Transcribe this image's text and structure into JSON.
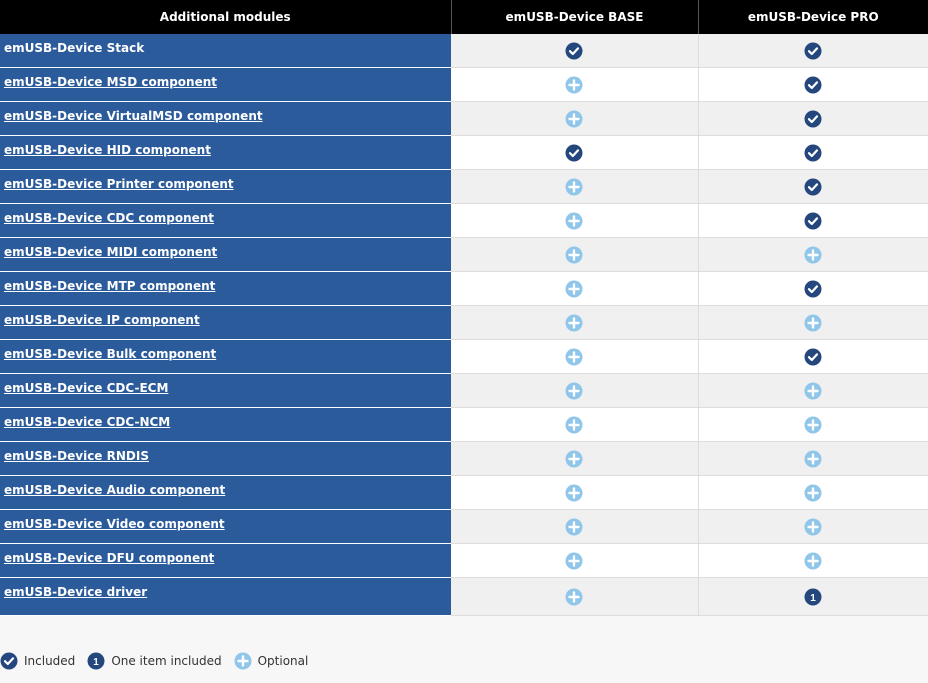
{
  "header": {
    "col1": "Additional modules",
    "col2": "emUSB-Device BASE",
    "col3": "emUSB-Device PRO"
  },
  "rows": [
    {
      "name": "emUSB-Device Stack",
      "base": "included",
      "pro": "included"
    },
    {
      "name": " emUSB-Device MSD component",
      "base": "optional",
      "pro": "included"
    },
    {
      "name": " emUSB-Device VirtualMSD component",
      "base": "optional",
      "pro": "included"
    },
    {
      "name": " emUSB-Device HID component",
      "base": "included",
      "pro": "included"
    },
    {
      "name": " emUSB-Device Printer component",
      "base": "optional",
      "pro": "included"
    },
    {
      "name": " emUSB-Device CDC component",
      "base": "optional",
      "pro": "included"
    },
    {
      "name": " emUSB-Device MIDI component",
      "base": "optional",
      "pro": "optional"
    },
    {
      "name": " emUSB-Device MTP component",
      "base": "optional",
      "pro": "included"
    },
    {
      "name": " emUSB-Device IP component",
      "base": "optional",
      "pro": "optional"
    },
    {
      "name": " emUSB-Device Bulk component",
      "base": "optional",
      "pro": "included"
    },
    {
      "name": " emUSB-Device CDC-ECM",
      "base": "optional",
      "pro": "optional"
    },
    {
      "name": " emUSB-Device CDC-NCM",
      "base": "optional",
      "pro": "optional"
    },
    {
      "name": " emUSB-Device RNDIS",
      "base": "optional",
      "pro": "optional"
    },
    {
      "name": " emUSB-Device Audio component",
      "base": "optional",
      "pro": "optional"
    },
    {
      "name": " emUSB-Device Video component",
      "base": "optional",
      "pro": "optional"
    },
    {
      "name": " emUSB-Device DFU component",
      "base": "optional",
      "pro": "optional"
    },
    {
      "name": " emUSB-Device driver",
      "base": "optional",
      "pro": "one"
    }
  ],
  "one_item_number": "1",
  "legend": {
    "included": "Included",
    "one": "One item included",
    "optional": "Optional"
  },
  "colors": {
    "header_bg": "#000000",
    "name_bg": "#2c5b9b",
    "included_icon": "#24477d",
    "optional_icon": "#8fc6ea"
  }
}
